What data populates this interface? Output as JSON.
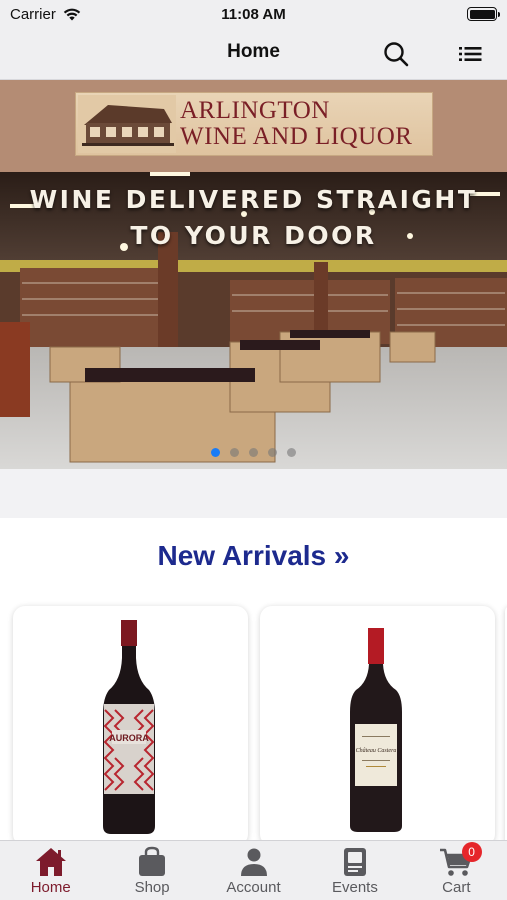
{
  "status_bar": {
    "carrier": "Carrier",
    "time": "11:08 AM",
    "icons": [
      "wifi-icon",
      "battery-icon"
    ]
  },
  "nav": {
    "title": "Home",
    "icons": [
      "search-icon",
      "list-menu-icon"
    ]
  },
  "logo": {
    "line1": "ARLINGTON",
    "line2": "WINE AND LIQUOR",
    "colors": {
      "banner": "#b48c74",
      "text": "#7a1f26"
    }
  },
  "hero": {
    "headline": "WINE DELIVERED STRAIGHT TO YOUR DOOR",
    "slides_count": 5,
    "active_slide": 1
  },
  "new_arrivals": {
    "title": "New Arrivals »",
    "products": [
      {
        "label_text": "AURORA",
        "icon": "wine-bottle-icon"
      },
      {
        "label_text": "Château Castera",
        "icon": "wine-bottle-icon"
      }
    ]
  },
  "tab_bar": {
    "tabs": [
      {
        "label": "Home",
        "icon": "home-icon",
        "active": true
      },
      {
        "label": "Shop",
        "icon": "bag-icon",
        "active": false
      },
      {
        "label": "Account",
        "icon": "person-icon",
        "active": false
      },
      {
        "label": "Events",
        "icon": "events-icon",
        "active": false
      },
      {
        "label": "Cart",
        "icon": "cart-icon",
        "active": false
      }
    ],
    "cart_badge": "0",
    "colors": {
      "active": "#7d1b2c",
      "inactive": "#5a5a5e",
      "badge": "#e5262b"
    }
  }
}
